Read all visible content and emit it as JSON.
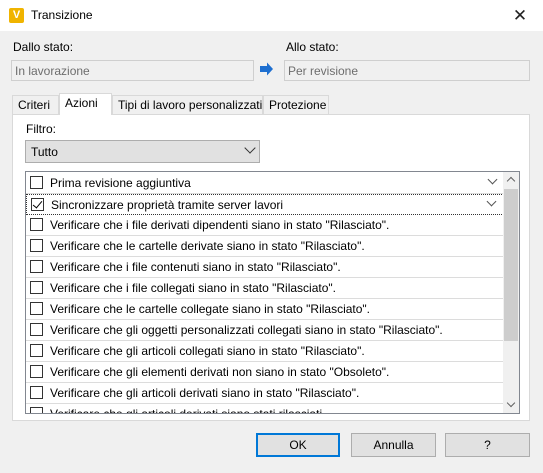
{
  "window": {
    "title": "Transizione",
    "app_icon_letter": "V",
    "close_glyph": "✕"
  },
  "from": {
    "label": "Dallo stato:",
    "value": "In lavorazione"
  },
  "to": {
    "label": "Allo stato:",
    "value": "Per revisione"
  },
  "tabs": [
    {
      "label": "Criteri",
      "active": false
    },
    {
      "label": "Azioni",
      "active": true
    },
    {
      "label": "Tipi di lavoro personalizzati",
      "active": false
    },
    {
      "label": "Protezione",
      "active": false
    }
  ],
  "filter": {
    "label": "Filtro:",
    "value": "Tutto"
  },
  "actions": [
    {
      "label": "Prima revisione aggiuntiva",
      "checked": false,
      "expandable": true
    },
    {
      "label": "Sincronizzare proprietà tramite server lavori",
      "checked": true,
      "expandable": true
    },
    {
      "label": "Verificare che i file derivati dipendenti siano in stato \"Rilasciato\".",
      "checked": false,
      "expandable": false
    },
    {
      "label": "Verificare che le cartelle derivate siano in stato \"Rilasciato\".",
      "checked": false,
      "expandable": false
    },
    {
      "label": "Verificare che i file contenuti siano in stato \"Rilasciato\".",
      "checked": false,
      "expandable": false
    },
    {
      "label": "Verificare che i file collegati siano in stato \"Rilasciato\".",
      "checked": false,
      "expandable": false
    },
    {
      "label": "Verificare che le cartelle collegate siano in stato \"Rilasciato\".",
      "checked": false,
      "expandable": false
    },
    {
      "label": "Verificare che gli oggetti personalizzati collegati siano in stato \"Rilasciato\".",
      "checked": false,
      "expandable": false
    },
    {
      "label": "Verificare che gli articoli collegati siano in stato \"Rilasciato\".",
      "checked": false,
      "expandable": false
    },
    {
      "label": "Verificare che gli elementi derivati non siano in stato \"Obsoleto\".",
      "checked": false,
      "expandable": false
    },
    {
      "label": "Verificare che gli articoli derivati siano in stato \"Rilasciato\".",
      "checked": false,
      "expandable": false
    },
    {
      "label": "Verificare che gli articoli derivati siano stati rilasciati",
      "checked": false,
      "expandable": false
    }
  ],
  "buttons": {
    "ok": "OK",
    "cancel": "Annulla",
    "help": "?"
  },
  "colors": {
    "arrow": "#1e6fd0",
    "focus": "#0078d7"
  }
}
